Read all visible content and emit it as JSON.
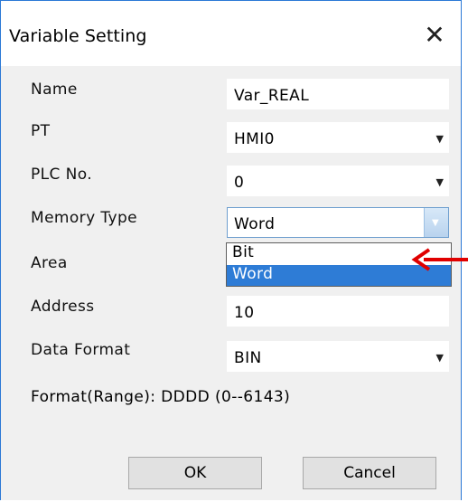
{
  "dialog": {
    "title": "Variable Setting",
    "close_glyph": "✕"
  },
  "fields": {
    "name": {
      "label": "Name",
      "value": "Var_REAL"
    },
    "pt": {
      "label": "PT",
      "value": "HMI0"
    },
    "plc_no": {
      "label": "PLC No.",
      "value": "0"
    },
    "memory_type": {
      "label": "Memory Type",
      "value": "Word"
    },
    "area": {
      "label": "Area"
    },
    "address": {
      "label": "Address",
      "value": "10"
    },
    "data_format": {
      "label": "Data Format",
      "value": "BIN"
    }
  },
  "dropdown": {
    "options": [
      "Bit",
      "Word"
    ],
    "selected": "Word"
  },
  "format_range": "Format(Range):  DDDD (0--6143)",
  "buttons": {
    "ok": "OK",
    "cancel": "Cancel"
  },
  "icons": {
    "dropdown_arrow": "▼",
    "annotation_arrow": "arrow-left-icon"
  },
  "colors": {
    "highlight": "#2e7cd6",
    "annotation": "#e00000",
    "title_border": "#2b79d6"
  }
}
